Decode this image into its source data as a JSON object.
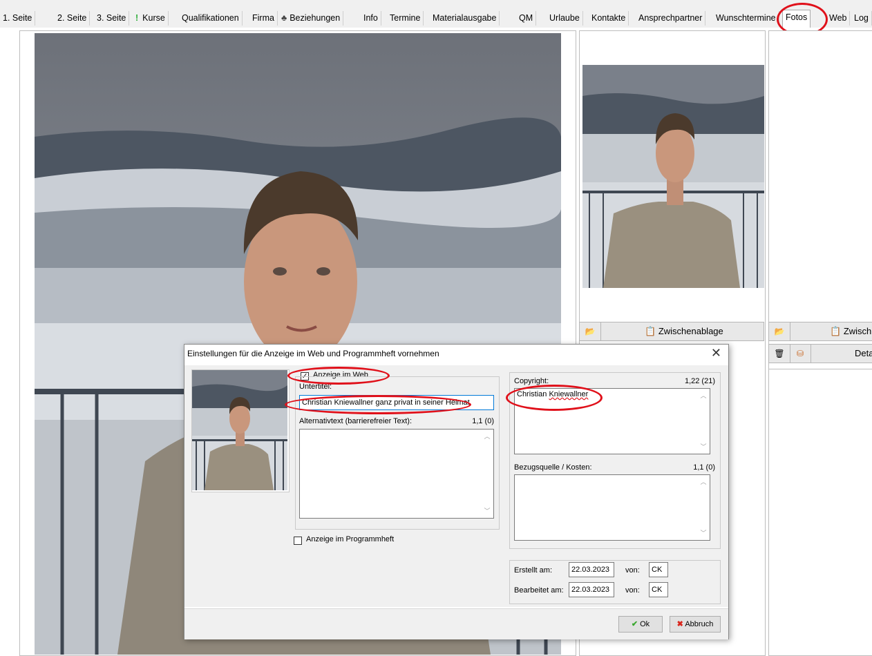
{
  "tabs": [
    {
      "label": "1. Seite"
    },
    {
      "label": "2. Seite"
    },
    {
      "label": "3. Seite"
    },
    {
      "label": "Kurse",
      "icon": "exclamation-icon"
    },
    {
      "label": "Qualifikationen"
    },
    {
      "label": "Firma"
    },
    {
      "label": "Beziehungen",
      "icon": "tree-icon"
    },
    {
      "label": "Info"
    },
    {
      "label": "Termine"
    },
    {
      "label": "Materialausgabe"
    },
    {
      "label": "QM"
    },
    {
      "label": "Urlaube"
    },
    {
      "label": "Kontakte"
    },
    {
      "label": "Ansprechpartner"
    },
    {
      "label": "Wunschtermine"
    },
    {
      "label": "Fotos",
      "active": true
    },
    {
      "label": "Web"
    },
    {
      "label": "Log"
    }
  ],
  "photo_panel_1": {
    "clipboard_label": "Zwischenablage"
  },
  "photo_panel_2": {
    "clipboard_label": "Zwisch",
    "details_label": "Deta"
  },
  "dialog": {
    "title": "Einstellungen für die Anzeige im Web und Programmheft vornehmen",
    "close_glyph": "✕",
    "show_web_label": "Anzeige im Web",
    "show_web_checked": true,
    "subtitle_label": "Untertitel:",
    "subtitle_value": "Christian Kniewallner ganz privat in seiner Heimat",
    "alt_text_label": "Alternativtext (barrierefreier Text):",
    "alt_text_count": "1,1 (0)",
    "alt_text_value": "",
    "show_program_label": "Anzeige im Programmheft",
    "show_program_checked": false,
    "copyright_label": "Copyright:",
    "copyright_count": "1,22 (21)",
    "copyright_value_first": "Christian",
    "copyright_value_second": "Kniewallner",
    "source_label": "Bezugsquelle / Kosten:",
    "source_count": "1,1 (0)",
    "source_value": "",
    "created_label": "Erstellt am:",
    "created_date": "22.03.2023",
    "created_by_label": "von:",
    "created_by": "CK",
    "edited_label": "Bearbeitet am:",
    "edited_date": "22.03.2023",
    "edited_by_label": "von:",
    "edited_by": "CK",
    "ok_label": "Ok",
    "cancel_label": "Abbruch"
  },
  "colors": {
    "annotation_red": "#e0101a",
    "ok_check_green": "#3aa82f",
    "cancel_x_red": "#d9261c",
    "focus_blue": "#0078d7"
  }
}
